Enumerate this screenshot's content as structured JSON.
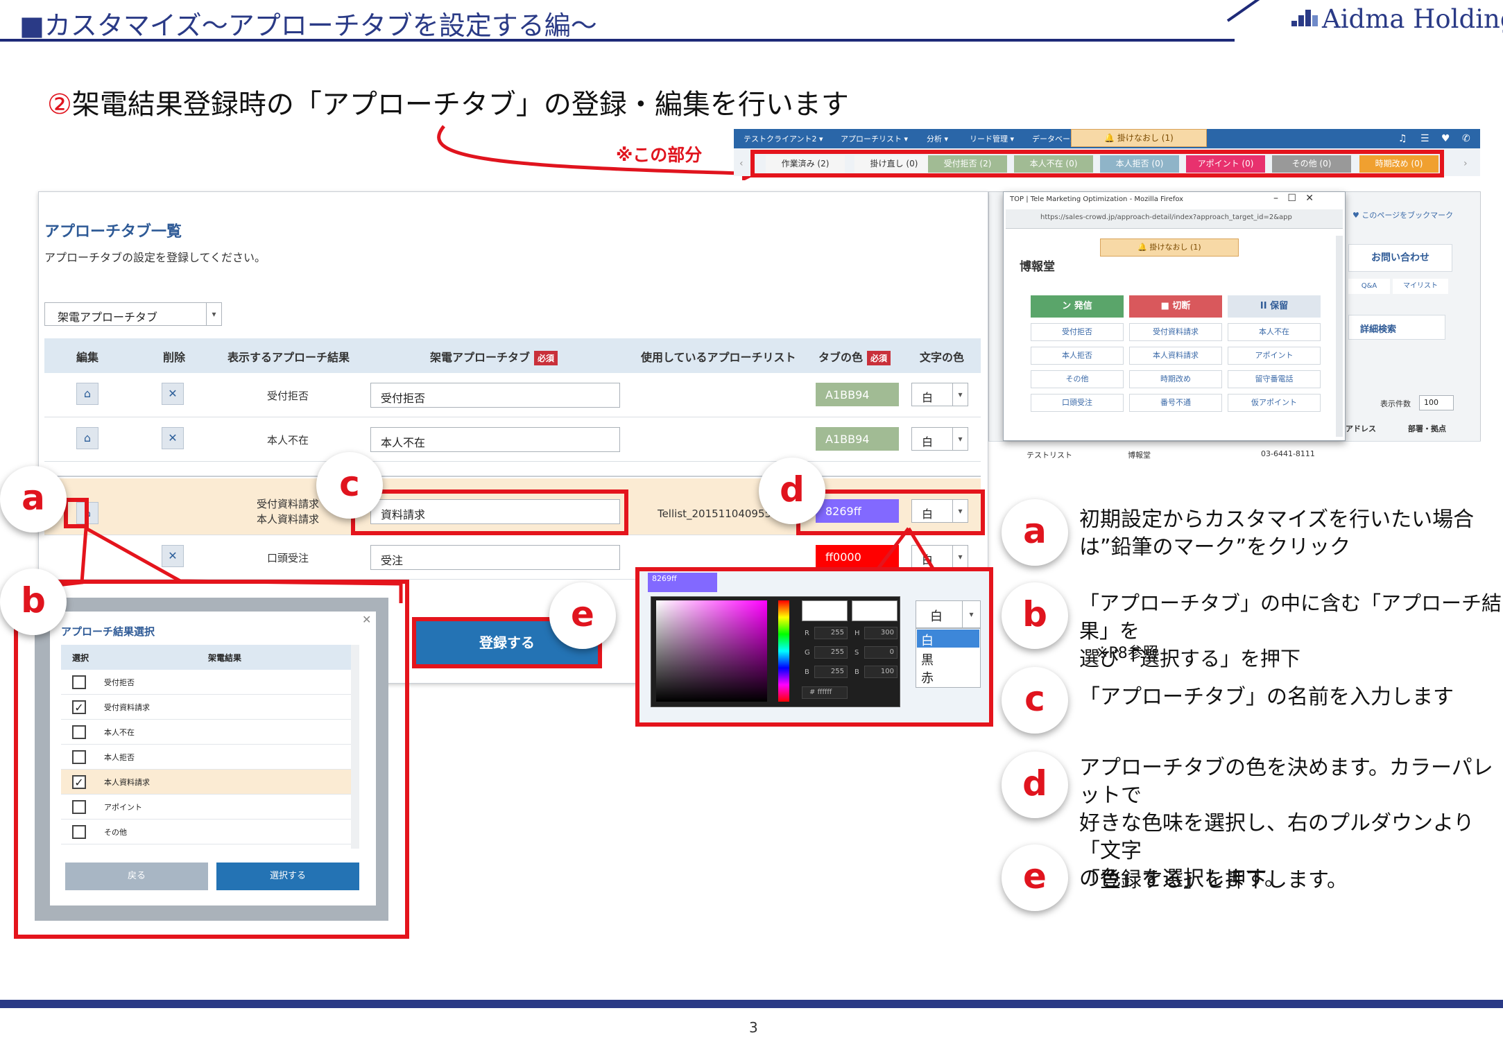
{
  "header": {
    "title": "■カスタマイズ〜アプローチタブを設定する編〜",
    "logo": "Aidma Holdings"
  },
  "subtitle": {
    "num": "②",
    "text": "架電結果登録時の「アプローチタブ」の登録・編集を行います"
  },
  "callout_label": "※この部分",
  "top_screenshot": {
    "nav": [
      "テストクライアント2 ▾",
      "アプローチリスト ▾",
      "分析 ▾",
      "リード管理 ▾",
      "データベース"
    ],
    "notification": "🔔 掛けなおし (1)",
    "tabs": [
      {
        "label": "作業済み (2)",
        "color": "#f5f5f5",
        "text": "#333"
      },
      {
        "label": "掛け直し (0)",
        "color": "#f5f5f5",
        "text": "#333"
      },
      {
        "label": "受付拒否 (2)",
        "color": "#A1BB94",
        "text": "#fff"
      },
      {
        "label": "本人不在 (0)",
        "color": "#A1BB94",
        "text": "#fff"
      },
      {
        "label": "本人拒否 (0)",
        "color": "#8fb4c8",
        "text": "#fff"
      },
      {
        "label": "アポイント (0)",
        "color": "#e8316e",
        "text": "#fff"
      },
      {
        "label": "その他 (0)",
        "color": "#999999",
        "text": "#fff"
      },
      {
        "label": "時期改め (0)",
        "color": "#f0a030",
        "text": "#fff"
      }
    ]
  },
  "app": {
    "section_title": "アプローチタブ一覧",
    "section_sub": "アプローチタブの設定を登録してください。",
    "select_value": "架電アプローチタブ",
    "columns": [
      "編集",
      "削除",
      "表示するアプローチ結果",
      "架電アプローチタブ",
      "使用しているアプローチリスト",
      "タブの色",
      "文字の色"
    ],
    "required": "必須",
    "rows": [
      {
        "result": "受付拒否",
        "tab": "受付拒否",
        "list": "",
        "color": "A1BB94",
        "hex": "#A1BB94",
        "font": "白"
      },
      {
        "result": "本人不在",
        "tab": "本人不在",
        "list": "",
        "color": "A1BB94",
        "hex": "#A1BB94",
        "font": "白"
      },
      {
        "result": "受付資料請求\n本人資料請求",
        "tab": "資料請求",
        "list": "Tellist_201511040955",
        "color": "8269ff",
        "hex": "#8269ff",
        "font": "白"
      },
      {
        "result": "口頭受注",
        "tab": "受注",
        "list": "",
        "color": "ff0000",
        "hex": "#ff0000",
        "font": "白"
      }
    ],
    "register_button": "登録する"
  },
  "firefox": {
    "title": "TOP | Tele Marketing Optimization - Mozilla Firefox",
    "url": "https://sales-crowd.jp/approach-detail/index?approach_target_id=2&app",
    "notification": "🔔 掛けなおし (1)",
    "company": "博報堂",
    "actions": [
      "ン 発信",
      "■ 切断",
      "II 保留"
    ],
    "buttons": [
      "受付拒否",
      "受付資料請求",
      "本人不在",
      "本人拒否",
      "本人資料請求",
      "アポイント",
      "その他",
      "時期改め",
      "留守番電話",
      "口頭受注",
      "番号不通",
      "仮アポイント"
    ]
  },
  "bg_app": {
    "bookmark": "♥ このページをブックマーク",
    "contact": "お問い合わせ",
    "qa": "Q&A",
    "mylist": "マイリスト",
    "detail_search": "詳細検索",
    "display_count": "表示件数",
    "count_value": "100",
    "address": "アドレス",
    "dept": "部署・拠点",
    "row_list": "テストリスト",
    "row_company": "博報堂",
    "row_phone": "03-6441-8111"
  },
  "modal": {
    "title": "アプローチ結果選択",
    "col_select": "選択",
    "col_result": "架電結果",
    "items": [
      {
        "label": "受付拒否",
        "checked": ""
      },
      {
        "label": "受付資料請求",
        "checked": "✓"
      },
      {
        "label": "本人不在",
        "checked": ""
      },
      {
        "label": "本人拒否",
        "checked": ""
      },
      {
        "label": "本人資料請求",
        "checked": "✓"
      },
      {
        "label": "アポイント",
        "checked": ""
      },
      {
        "label": "その他",
        "checked": ""
      }
    ],
    "back": "戻る",
    "select": "選択する"
  },
  "picker": {
    "fields": [
      "R",
      "255",
      "H",
      "300",
      "G",
      "255",
      "S",
      "0",
      "B",
      "255",
      "B",
      "100"
    ],
    "hex": "ffffff",
    "mini_color": "8269ff"
  },
  "font_dropdown": {
    "value": "白",
    "options": [
      "白",
      "黒",
      "赤"
    ]
  },
  "annotations": {
    "a": {
      "letter": "a",
      "text": "初期設定からカスタマイズを行いたい場合\nは”鉛筆のマーク”をクリック"
    },
    "b": {
      "letter": "b",
      "text": "「アプローチタブ」の中に含む「アプローチ結果」を\n選び「選択する」を押下",
      "note": "※P8参照"
    },
    "c": {
      "letter": "c",
      "text": "「アプローチタブ」の名前を入力します"
    },
    "d": {
      "letter": "d",
      "text": "アプローチタブの色を決めます。カラーパレットで\n好きな色味を選択し、右のプルダウンより「文字\nの色」を選択します。"
    },
    "e": {
      "letter": "e",
      "text": "「登録する」を押下します。"
    }
  },
  "page_number": "3"
}
